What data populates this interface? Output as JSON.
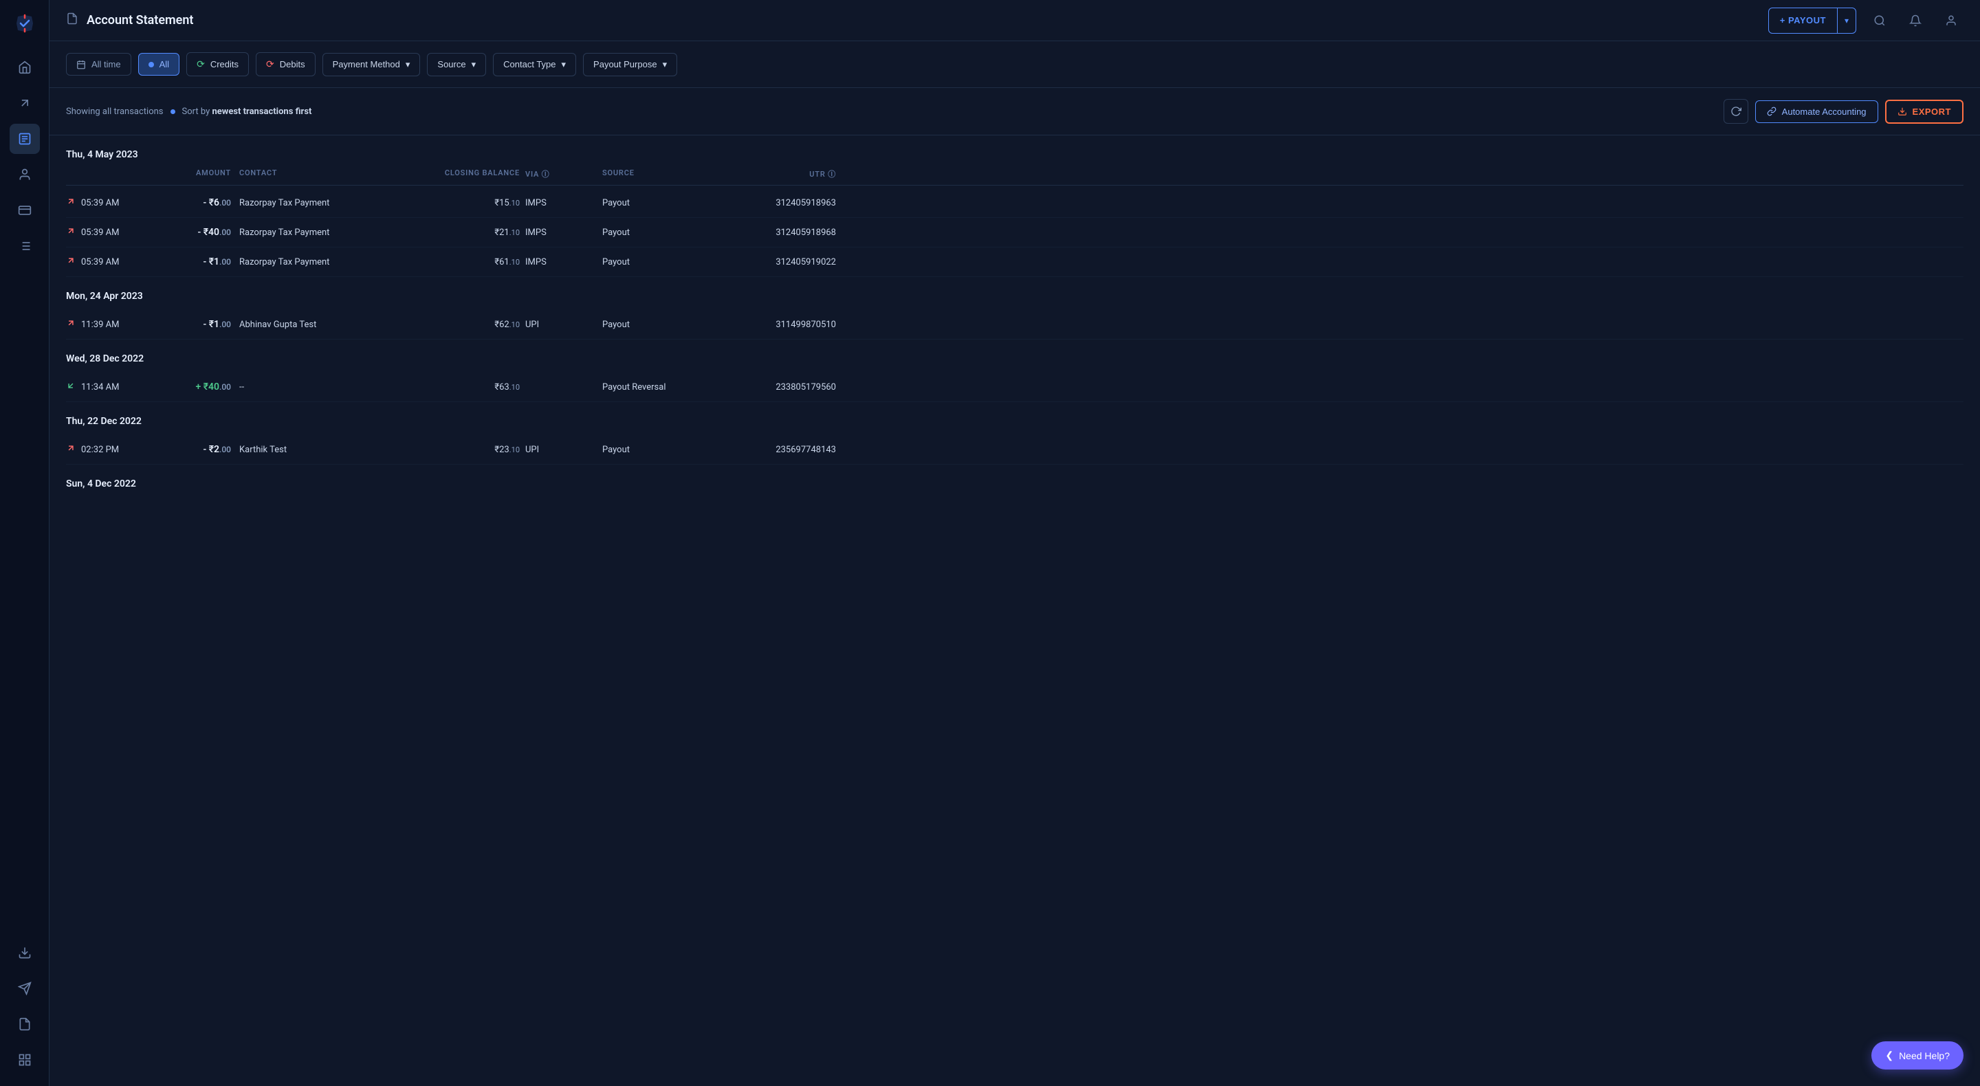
{
  "header": {
    "title": "Account Statement",
    "payout_btn": "+ PAYOUT",
    "payout_dropdown_icon": "▾"
  },
  "filters": {
    "time_label": "All time",
    "all_label": "All",
    "credits_label": "Credits",
    "debits_label": "Debits",
    "payment_method_label": "Payment Method",
    "source_label": "Source",
    "contact_type_label": "Contact Type",
    "payout_purpose_label": "Payout Purpose"
  },
  "transactions_bar": {
    "showing_text": "Showing all transactions",
    "sort_prefix": "Sort by ",
    "sort_value": "newest transactions first",
    "automate_label": "Automate Accounting",
    "export_label": "EXPORT"
  },
  "table": {
    "headers": [
      "",
      "AMOUNT",
      "CONTACT",
      "CLOSING BALANCE",
      "VIA",
      "SOURCE",
      "UTR"
    ],
    "date_groups": [
      {
        "date": "Thu, 4 May 2023",
        "rows": [
          {
            "time": "05:39 AM",
            "type": "debit",
            "amount_prefix": "- ₹",
            "amount": "6",
            "amount_decimal": ".00",
            "contact": "Razorpay Tax Payment",
            "closing": "₹15",
            "closing_decimal": ".10",
            "via": "IMPS",
            "source": "Payout",
            "utr": "312405918963"
          },
          {
            "time": "05:39 AM",
            "type": "debit",
            "amount_prefix": "- ₹",
            "amount": "40",
            "amount_decimal": ".00",
            "contact": "Razorpay Tax Payment",
            "closing": "₹21",
            "closing_decimal": ".10",
            "via": "IMPS",
            "source": "Payout",
            "utr": "312405918968"
          },
          {
            "time": "05:39 AM",
            "type": "debit",
            "amount_prefix": "- ₹",
            "amount": "1",
            "amount_decimal": ".00",
            "contact": "Razorpay Tax Payment",
            "closing": "₹61",
            "closing_decimal": ".10",
            "via": "IMPS",
            "source": "Payout",
            "utr": "312405919022"
          }
        ]
      },
      {
        "date": "Mon, 24 Apr 2023",
        "rows": [
          {
            "time": "11:39 AM",
            "type": "debit",
            "amount_prefix": "- ₹",
            "amount": "1",
            "amount_decimal": ".00",
            "contact": "Abhinav Gupta Test",
            "closing": "₹62",
            "closing_decimal": ".10",
            "via": "UPI",
            "source": "Payout",
            "utr": "311499870510"
          }
        ]
      },
      {
        "date": "Wed, 28 Dec 2022",
        "rows": [
          {
            "time": "11:34 AM",
            "type": "credit",
            "amount_prefix": "+ ₹",
            "amount": "40",
            "amount_decimal": ".00",
            "contact": "--",
            "closing": "₹63",
            "closing_decimal": ".10",
            "via": "",
            "source": "Payout Reversal",
            "utr": "233805179560"
          }
        ]
      },
      {
        "date": "Thu, 22 Dec 2022",
        "rows": [
          {
            "time": "02:32 PM",
            "type": "debit",
            "amount_prefix": "- ₹",
            "amount": "2",
            "amount_decimal": ".00",
            "contact": "Karthik Test",
            "closing": "₹23",
            "closing_decimal": ".10",
            "via": "UPI",
            "source": "Payout",
            "utr": "235697748143"
          }
        ]
      },
      {
        "date": "Sun, 4 Dec 2022",
        "rows": []
      }
    ]
  },
  "sidebar": {
    "items": [
      {
        "name": "home",
        "icon": "⌂"
      },
      {
        "name": "arrow-up",
        "icon": "↗"
      },
      {
        "name": "document",
        "icon": "📄"
      },
      {
        "name": "person",
        "icon": "👤"
      },
      {
        "name": "card",
        "icon": "💳"
      },
      {
        "name": "list",
        "icon": "☰"
      },
      {
        "name": "download",
        "icon": "⬇"
      },
      {
        "name": "send",
        "icon": "✈"
      },
      {
        "name": "file",
        "icon": "🗋"
      },
      {
        "name": "grid",
        "icon": "⊞"
      }
    ]
  },
  "help": {
    "label": "Need Help?"
  }
}
